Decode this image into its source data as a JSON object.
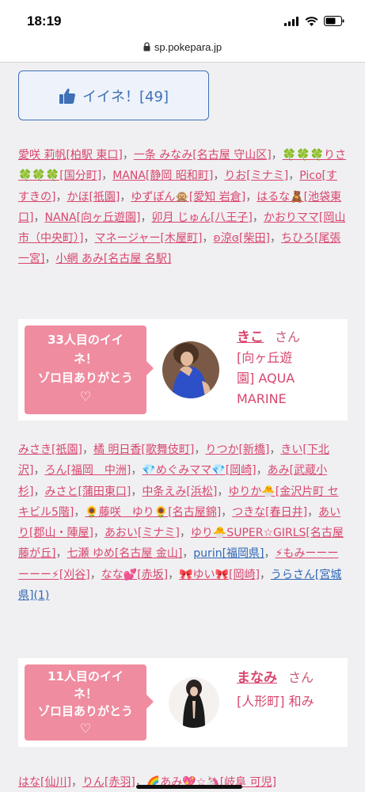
{
  "status": {
    "time": "18:19"
  },
  "browser": {
    "url": "sp.pokepara.jp"
  },
  "like_button": {
    "label": "イイネ！[49]"
  },
  "likers_a": [
    {
      "text": "愛咲 莉帆[柏駅 東口]"
    },
    {
      "text": "一条 みなみ[名古屋 守山区]"
    },
    {
      "text": "🍀🍀🍀りさ🍀🍀🍀[国分町]"
    },
    {
      "text": "MANA[静岡 昭和町]"
    },
    {
      "text": "りお[ミナミ]"
    },
    {
      "text": "Pico[すすきの]"
    },
    {
      "text": "かほ[祇園]"
    },
    {
      "text": "ゆずぽん🙊[愛知 岩倉]"
    },
    {
      "text": "はるな🧸[池袋東口]"
    },
    {
      "text": "NANA[向ヶ丘遊園]"
    },
    {
      "text": "卯月 じゅん[八王子]"
    },
    {
      "text": "かおりママ[岡山市（中央町）]"
    },
    {
      "text": "マネージャー[木屋町]"
    },
    {
      "text": "ʚ涼ɞ[柴田]"
    },
    {
      "text": "ちひろ[尾張 一宮]"
    },
    {
      "text": "小網 あみ[名古屋 名駅]"
    }
  ],
  "card1": {
    "bubble_line1": "33人目のイイ",
    "bubble_line2": "ネ！",
    "bubble_line3": "ゾロ目ありがとう",
    "bubble_heart": "♡",
    "name": "きこ",
    "honorific": "さん",
    "area_line1": "[向ヶ丘遊",
    "area_line2": "園] AQUA",
    "area_line3": "MARINE"
  },
  "likers_b": [
    {
      "text": "みさき[祇園]"
    },
    {
      "text": "橘 明日香[歌舞伎町]"
    },
    {
      "text": "りつか[新橋]"
    },
    {
      "text": "きい[下北沢]"
    },
    {
      "text": "ろん[福岡　中洲]"
    },
    {
      "text": "💎めぐみママ💎[岡崎]"
    },
    {
      "text": "あみ[武蔵小杉]"
    },
    {
      "text": "みさと[蒲田東口]"
    },
    {
      "text": "中条えみ[浜松]"
    },
    {
      "text": "ゆりか🐣[金沢片町 セキビル5階]"
    },
    {
      "text": "🌻藤咲　ゆり🌻[名古屋錦]"
    },
    {
      "text": "つきな[春日井]"
    },
    {
      "text": "あいり[郡山・陣屋]"
    },
    {
      "text": "あおい[ミナミ]"
    },
    {
      "text": "ゆり🐣SUPER☆GIRLS[名古屋 藤が丘]"
    },
    {
      "text": "七瀬 ゆめ[名古屋 金山]"
    },
    {
      "text": "purin[福岡県]",
      "blue": true
    },
    {
      "text": "⚡もみーーーーーー⚡[刈谷]"
    },
    {
      "text": "なな💕[赤坂]"
    },
    {
      "text": "🎀ゆい🎀[岡崎]"
    },
    {
      "text": "うらさん[宮城県](1)",
      "blue": true
    }
  ],
  "card2": {
    "bubble_line1": "11人目のイイ",
    "bubble_line2": "ネ！",
    "bubble_line3": "ゾロ目ありがとう",
    "bubble_heart": "♡",
    "name": "まなみ",
    "honorific": "さん",
    "area_line1": "[人形町] 和み"
  },
  "likers_c": [
    {
      "text": "はな[仙川]"
    },
    {
      "text": "りん[赤羽]"
    },
    {
      "text": "🌈あみ💖☆🦄[岐阜 可児]"
    }
  ],
  "colors": {
    "accent_pink": "#d9466e",
    "bubble_pink": "#ef8ca0",
    "link_blue": "#2f67b5",
    "like_blue": "#3f6fb5"
  }
}
